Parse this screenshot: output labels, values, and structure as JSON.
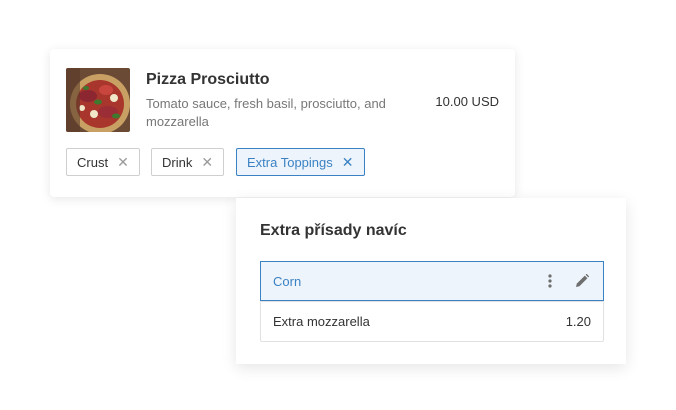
{
  "item": {
    "title": "Pizza Prosciutto",
    "description": "Tomato sauce, fresh basil, prosciutto, and mozzarella",
    "price": "10.00 USD"
  },
  "modifier_chips": [
    {
      "label": "Crust",
      "active": false
    },
    {
      "label": "Drink",
      "active": false
    },
    {
      "label": "Extra Toppings",
      "active": true
    }
  ],
  "popover": {
    "title": "Extra přísady navíc",
    "options": [
      {
        "label": "Corn",
        "price": "",
        "selected": true
      },
      {
        "label": "Extra mozzarella",
        "price": "1.20",
        "selected": false
      }
    ]
  },
  "colors": {
    "accent": "#3b82c4",
    "selected_bg": "#eef4fb"
  },
  "icons": {
    "chip_remove": "close-icon",
    "row_menu": "more-vertical-icon",
    "row_edit": "pencil-icon"
  }
}
